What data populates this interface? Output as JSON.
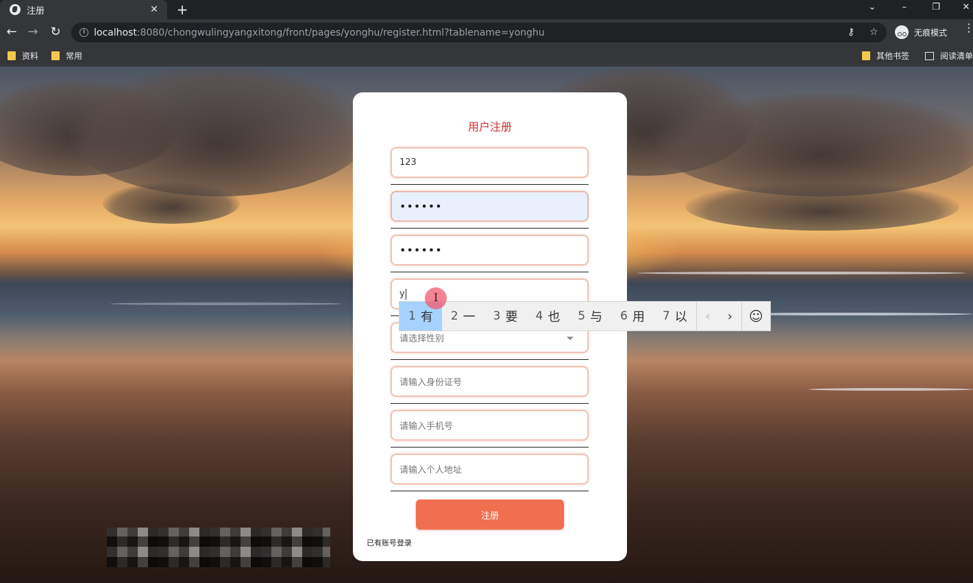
{
  "browser": {
    "tab_title": "注册",
    "tab_close": "✕",
    "new_tab": "+",
    "url_host": "localhost",
    "url_rest": ":8080/chongwulingyangxitong/front/pages/yonghu/register.html?tablename=yonghu",
    "incognito_label": "无痕模式",
    "bookmarks": [
      "资料",
      "常用"
    ],
    "bookmarks_right": [
      "其他书签",
      "阅读清单"
    ]
  },
  "form": {
    "title": "用户注册",
    "username_value": "123",
    "password_value": "••••••",
    "confirm_value": "••••••",
    "name_value": "y",
    "gender_placeholder": "请选择性别",
    "idcard_placeholder": "请输入身份证号",
    "phone_placeholder": "请输入手机号",
    "address_placeholder": "请输入个人地址",
    "submit_label": "注册",
    "login_link": "已有账号登录"
  },
  "ime": {
    "candidates": [
      {
        "num": "1",
        "char": "有"
      },
      {
        "num": "2",
        "char": "一"
      },
      {
        "num": "3",
        "char": "要"
      },
      {
        "num": "4",
        "char": "也"
      },
      {
        "num": "5",
        "char": "与"
      },
      {
        "num": "6",
        "char": "用"
      },
      {
        "num": "7",
        "char": "以"
      }
    ],
    "selected_index": 0
  },
  "icons": {
    "back": "back-arrow-icon",
    "forward": "forward-arrow-icon",
    "reload": "reload-icon",
    "key": "key-icon",
    "star": "star-icon",
    "emoji": "emoji-icon"
  }
}
